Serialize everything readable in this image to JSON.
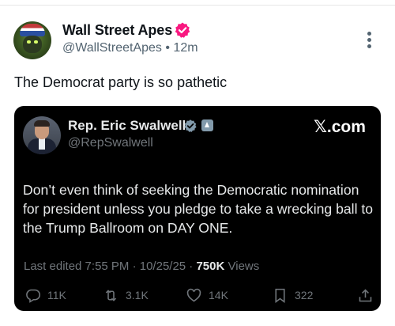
{
  "post": {
    "author": {
      "name": "Wall Street Apes",
      "handle": "@WallStreetApes",
      "time": "12m",
      "verified": true,
      "badge_color": "#f91880"
    },
    "text": "The Democrat party is so pathetic"
  },
  "embed": {
    "author": {
      "name": "Rep. Eric Swalwell",
      "handle": "@RepSwalwell",
      "verified_badge_color": "#829aab",
      "gov_badge": "government-icon"
    },
    "watermark": "𝕏.com",
    "text": "Don’t even think of seeking the Democratic nomination for president unless you pledge to take a wrecking ball to the Trump Ballroom on DAY ONE.",
    "meta": {
      "edited": "Last edited 7:55 PM · 10/25/25 · ",
      "views_count": "750K",
      "views_label": "Views"
    },
    "actions": {
      "replies": "11K",
      "reposts": "3.1K",
      "likes": "14K",
      "bookmarks": "322"
    }
  },
  "icons": [
    "more-icon",
    "verified-icon",
    "reply-icon",
    "repost-icon",
    "like-icon",
    "bookmark-icon",
    "share-icon"
  ],
  "colors": {
    "text": "#0f1419",
    "secondary": "#536471",
    "embed_background": "#000000",
    "embed_text": "#e7e9ea",
    "embed_secondary": "#71767b"
  }
}
